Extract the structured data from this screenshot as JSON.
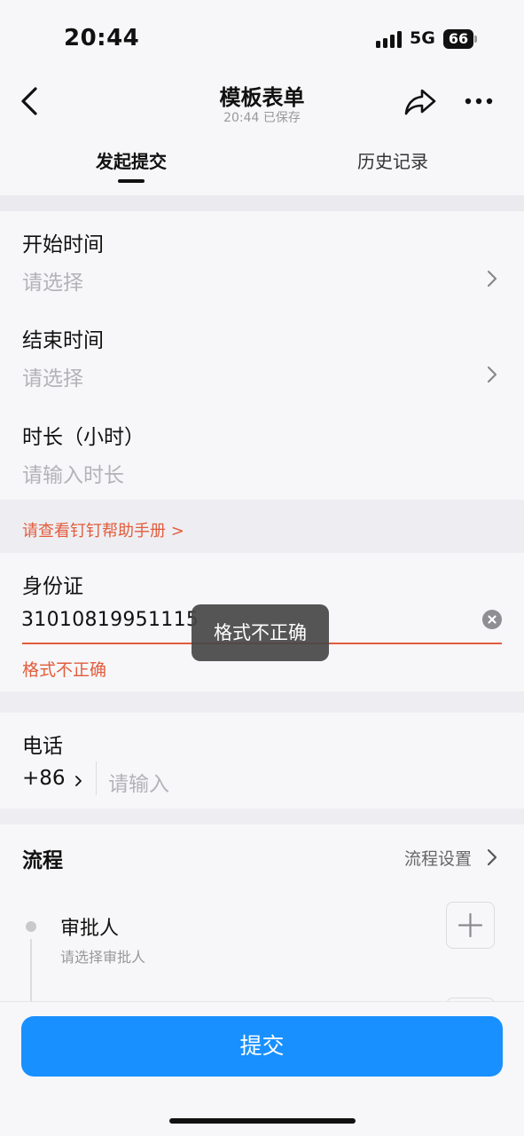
{
  "status_bar": {
    "time": "20:44",
    "network": "5G",
    "battery": "66"
  },
  "nav": {
    "title": "模板表单",
    "subtitle": "20:44 已保存"
  },
  "tabs": [
    {
      "label": "发起提交",
      "active": true
    },
    {
      "label": "历史记录",
      "active": false
    }
  ],
  "fields": {
    "start_time": {
      "label": "开始时间",
      "placeholder": "请选择"
    },
    "end_time": {
      "label": "结束时间",
      "placeholder": "请选择"
    },
    "duration": {
      "label": "时长（小时）",
      "placeholder": "请输入时长"
    }
  },
  "help_link": "请查看钉钉帮助手册 >",
  "id_card": {
    "label": "身份证",
    "value": "31010819951115",
    "error": "格式不正确"
  },
  "toast": "格式不正确",
  "phone": {
    "label": "电话",
    "country_code": "+86",
    "placeholder": "请输入"
  },
  "flow": {
    "title": "流程",
    "settings_label": "流程设置",
    "approver_label": "审批人",
    "approver_placeholder": "请选择审批人"
  },
  "submit_label": "提交",
  "colors": {
    "primary": "#1890ff",
    "error": "#e25c3c",
    "placeholder": "#b3b3b8"
  }
}
